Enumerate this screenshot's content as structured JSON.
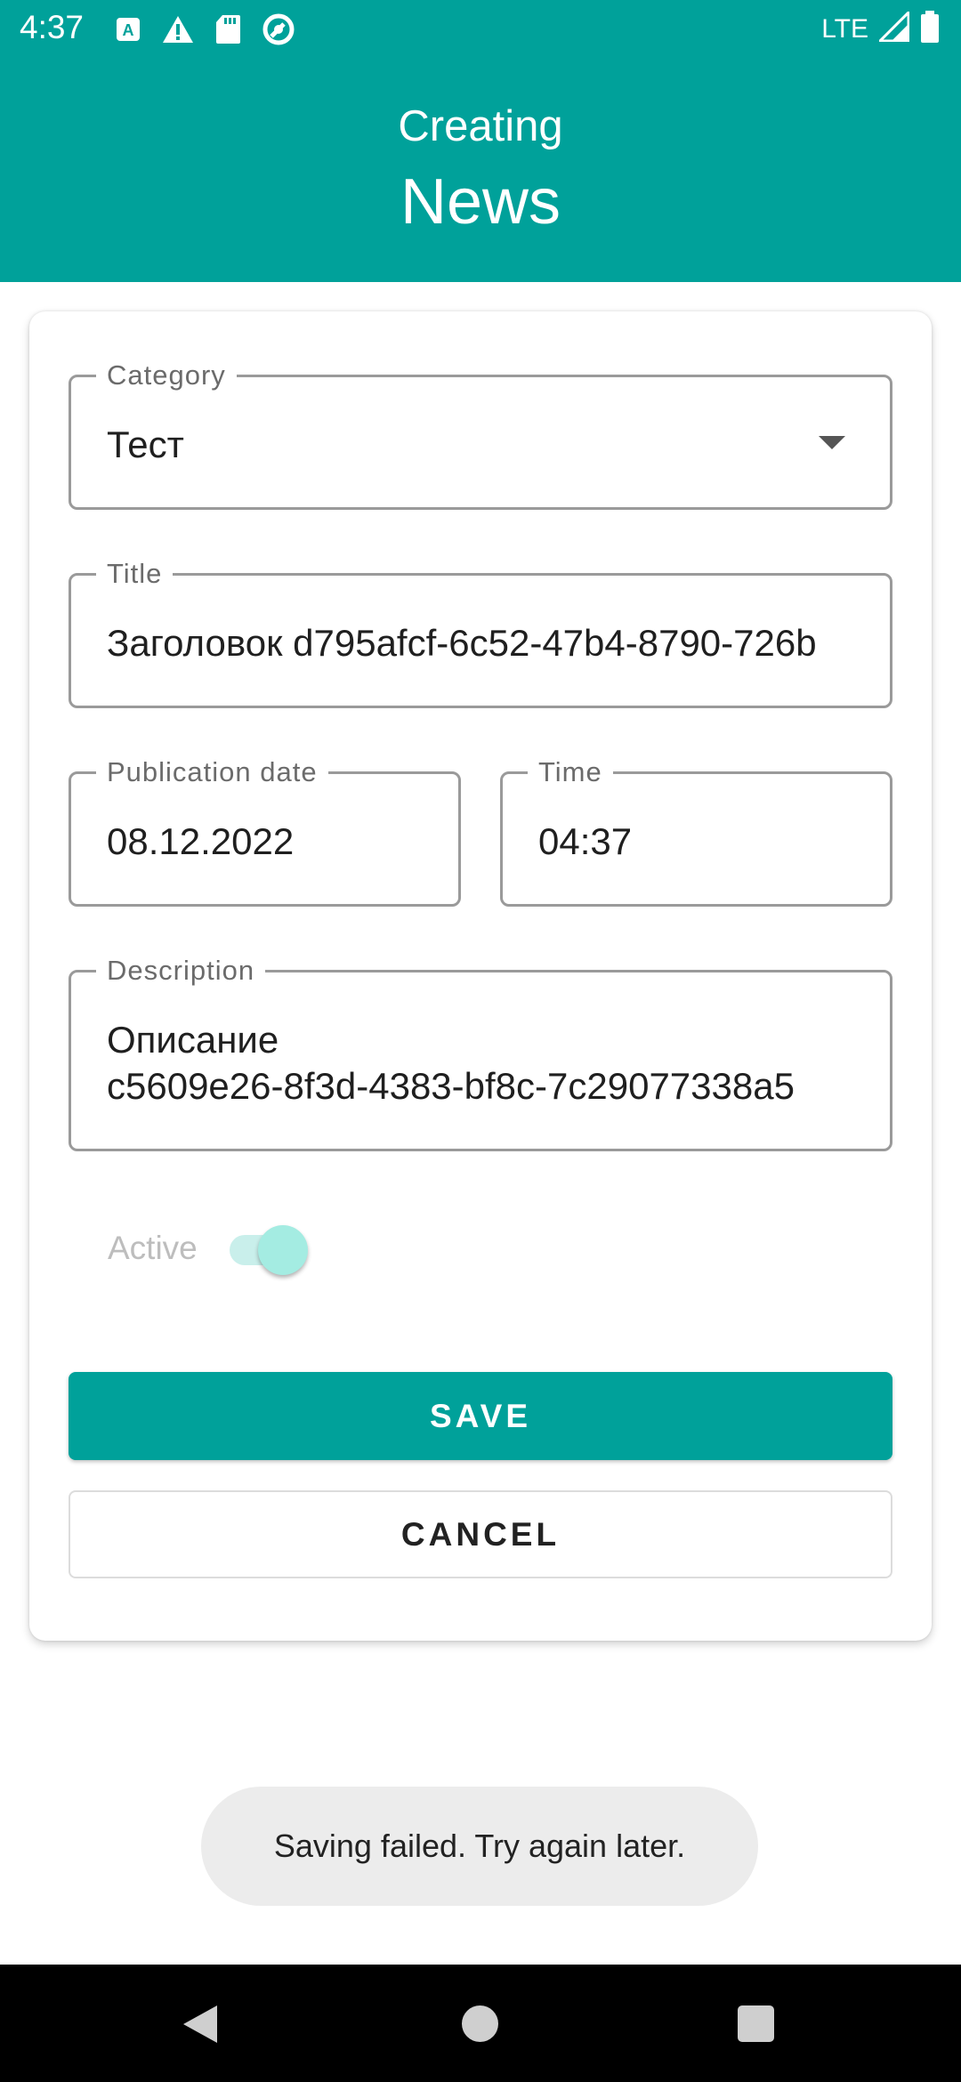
{
  "status_bar": {
    "time": "4:37",
    "network": "LTE",
    "left_icons": [
      "text-a-icon",
      "warning-icon",
      "sd-card-icon",
      "sync-icon"
    ],
    "right_icons": [
      "signal-icon",
      "battery-icon"
    ]
  },
  "header": {
    "subtitle": "Creating",
    "title": "News",
    "color": "#00a19a"
  },
  "form": {
    "category": {
      "label": "Category",
      "value": "Тест"
    },
    "title": {
      "label": "Title",
      "value": "Заголовок d795afcf-6c52-47b4-8790-726b"
    },
    "publication_date": {
      "label": "Publication date",
      "value": "08.12.2022"
    },
    "time": {
      "label": "Time",
      "value": "04:37"
    },
    "description": {
      "label": "Description",
      "line1": "Описание",
      "line2": "c5609e26-8f3d-4383-bf8c-7c29077338a5"
    },
    "active": {
      "label": "Active",
      "on": true
    }
  },
  "buttons": {
    "save": "SAVE",
    "cancel": "CANCEL"
  },
  "toast": {
    "message": "Saving failed. Try again later."
  },
  "nav_bar": {
    "icons": [
      "back-icon",
      "home-icon",
      "recents-icon"
    ]
  }
}
